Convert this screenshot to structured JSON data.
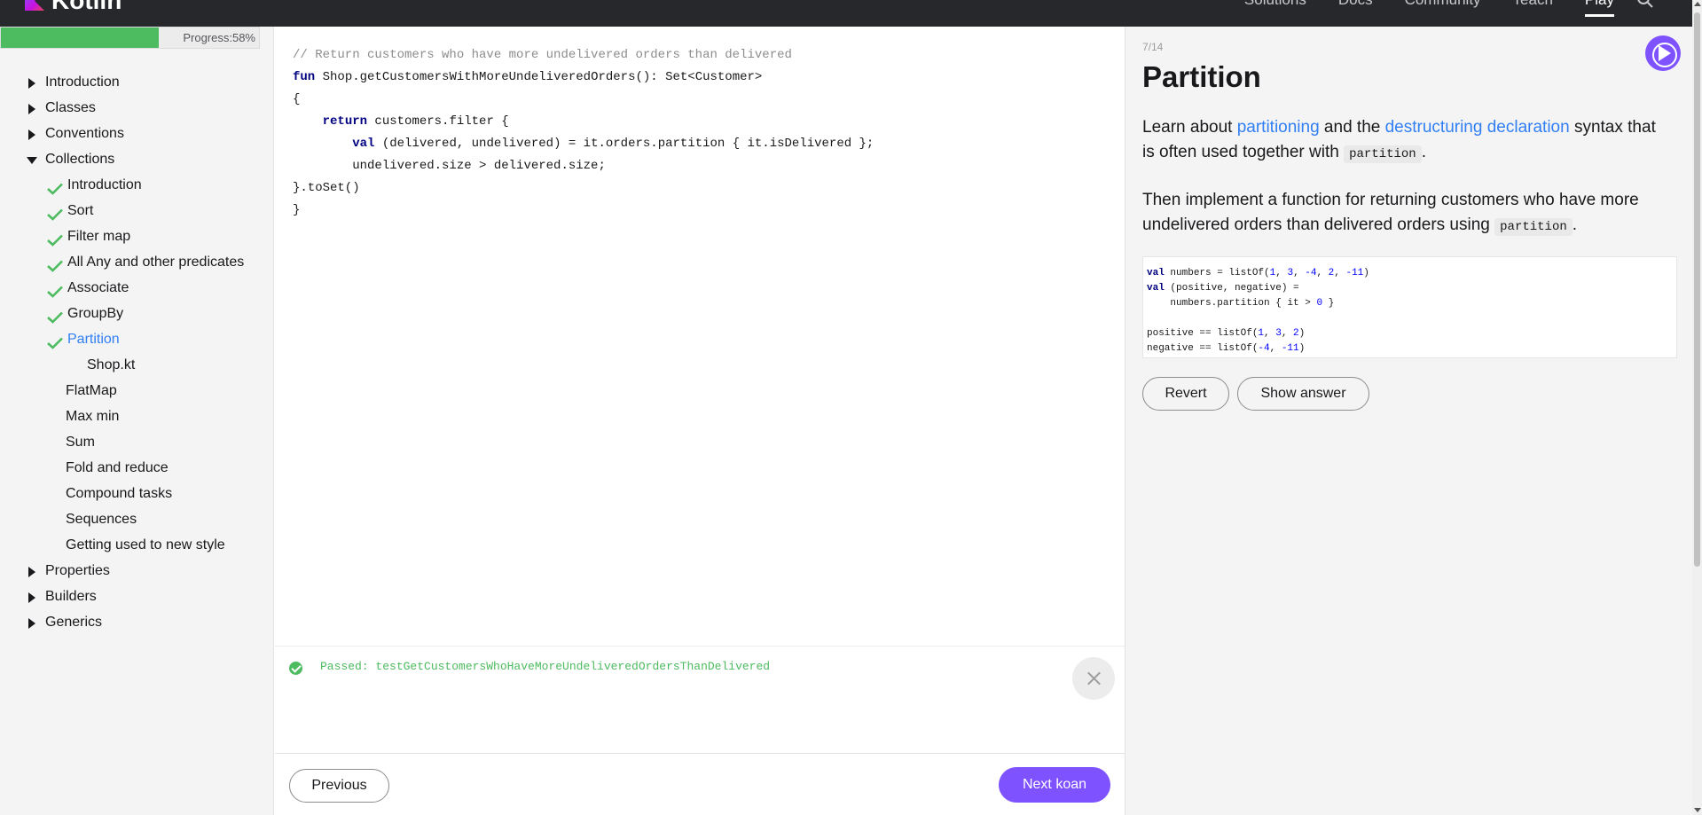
{
  "app": {
    "logo_text": "Kotlin"
  },
  "topnav": {
    "items": [
      "Solutions",
      "Docs",
      "Community",
      "Teach",
      "Play"
    ],
    "active": "Play"
  },
  "sidebar": {
    "progress": {
      "label": "Progress:58%",
      "percent": 58
    },
    "tree": [
      {
        "label": "Introduction",
        "kind": "section",
        "open": false
      },
      {
        "label": "Classes",
        "kind": "section",
        "open": false
      },
      {
        "label": "Conventions",
        "kind": "section",
        "open": false
      },
      {
        "label": "Collections",
        "kind": "section",
        "open": true
      },
      {
        "label": "Introduction",
        "kind": "task",
        "done": true
      },
      {
        "label": "Sort",
        "kind": "task",
        "done": true
      },
      {
        "label": "Filter map",
        "kind": "task",
        "done": true
      },
      {
        "label": "All Any and other predicates",
        "kind": "task",
        "done": true
      },
      {
        "label": "Associate",
        "kind": "task",
        "done": true
      },
      {
        "label": "GroupBy",
        "kind": "task",
        "done": true
      },
      {
        "label": "Partition",
        "kind": "task",
        "done": true,
        "active": true
      },
      {
        "label": "Shop.kt",
        "kind": "file"
      },
      {
        "label": "FlatMap",
        "kind": "task",
        "done": false
      },
      {
        "label": "Max min",
        "kind": "task",
        "done": false
      },
      {
        "label": "Sum",
        "kind": "task",
        "done": false
      },
      {
        "label": "Fold and reduce",
        "kind": "task",
        "done": false
      },
      {
        "label": "Compound tasks",
        "kind": "task",
        "done": false
      },
      {
        "label": "Sequences",
        "kind": "task",
        "done": false
      },
      {
        "label": "Getting used to new style",
        "kind": "task",
        "done": false
      },
      {
        "label": "Properties",
        "kind": "section",
        "open": false
      },
      {
        "label": "Builders",
        "kind": "section",
        "open": false
      },
      {
        "label": "Generics",
        "kind": "section",
        "open": false
      }
    ]
  },
  "editor": {
    "lines": [
      "// Return customers who have more undelivered orders than delivered",
      "fun Shop.getCustomersWithMoreUndeliveredOrders(): Set<Customer>",
      "{",
      "    return customers.filter {",
      "        val (delivered, undelivered) = it.orders.partition { it.isDelivered };",
      "        undelivered.size > delivered.size;",
      "}.toSet()",
      "}"
    ]
  },
  "console": {
    "message": "Passed: testGetCustomersWhoHaveMoreUndeliveredOrdersThanDelivered",
    "status": "passed"
  },
  "footer": {
    "previous_label": "Previous",
    "next_label": "Next koan"
  },
  "task": {
    "counter": "7/14",
    "title": "Partition",
    "desc1_a": "Learn about ",
    "desc1_link1": "partitioning",
    "desc1_b": " and the ",
    "desc1_link2": "destructuring declaration",
    "desc1_c": " syntax that is often used together with ",
    "desc1_code": "partition",
    "desc1_d": ".",
    "desc2_a": "Then implement a function for returning customers who have more undelivered orders than delivered orders using ",
    "desc2_code": "partition",
    "desc2_b": ".",
    "sample_lines": [
      "val numbers = listOf(1, 3, -4, 2, -11)",
      "val (positive, negative) =",
      "    numbers.partition { it > 0 }",
      "",
      "positive == listOf(1, 3, 2)",
      "negative == listOf(-4, -11)"
    ],
    "revert_label": "Revert",
    "show_answer_label": "Show answer"
  },
  "colors": {
    "accent": "#7f52ff",
    "link": "#307ff5",
    "success": "#4dbb5f",
    "nav_bg": "#27282c"
  }
}
